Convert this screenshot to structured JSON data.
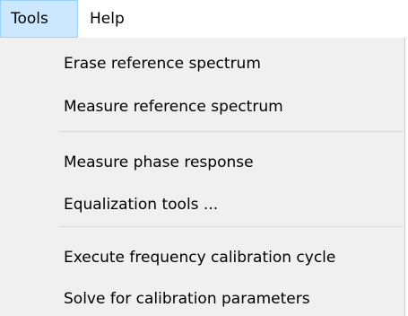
{
  "menubar": {
    "tools_label": "Tools",
    "help_label": "Help"
  },
  "tools_menu": {
    "items": [
      {
        "label": "Erase reference spectrum"
      },
      {
        "label": "Measure reference spectrum"
      },
      {
        "label": "Measure phase response"
      },
      {
        "label": "Equalization tools ..."
      },
      {
        "label": "Execute frequency calibration cycle"
      },
      {
        "label": "Solve for calibration parameters"
      }
    ]
  },
  "colors": {
    "menubar_background": "#ffffff",
    "active_menu_background": "#cce8ff",
    "active_menu_border": "#99d1ff",
    "dropdown_background": "#f0f0f0",
    "separator": "#d7d7d7",
    "text": "#000000"
  }
}
